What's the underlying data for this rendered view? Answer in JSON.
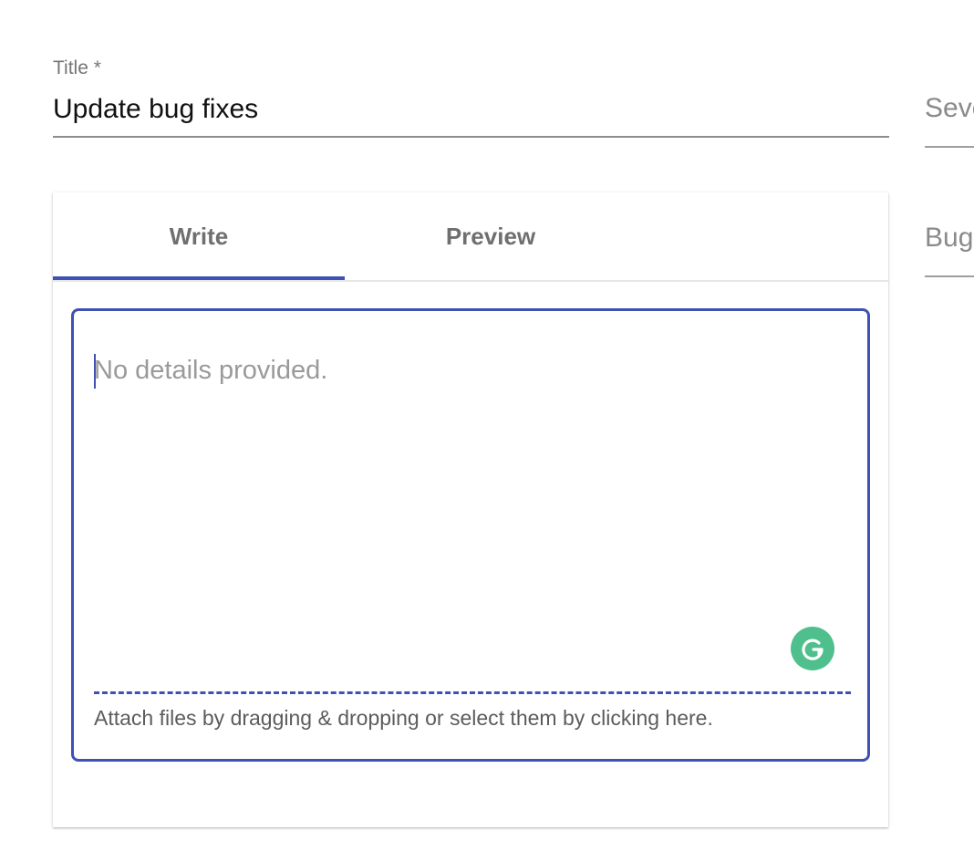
{
  "title_field": {
    "label": "Title *",
    "value": "Update bug fixes"
  },
  "side_fields": {
    "severity_placeholder": "Seve",
    "bug_placeholder": "Bug"
  },
  "tabs": [
    {
      "label": "Write",
      "active": true
    },
    {
      "label": "Preview",
      "active": false
    }
  ],
  "editor": {
    "placeholder": "No details provided.",
    "attach_text": "Attach files by dragging & dropping or select them by clicking here."
  },
  "colors": {
    "accent": "#3f51b5",
    "grammarly": "#4fc08d"
  },
  "icons": {
    "grammarly": "grammarly-icon"
  }
}
